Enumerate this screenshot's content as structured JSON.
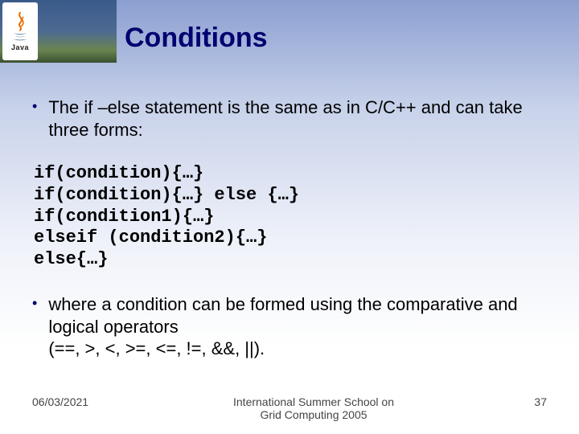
{
  "logo": {
    "text": "Java"
  },
  "title": "Conditions",
  "bullets": {
    "b1": "The if –else  statement is the same as in C/C++ and can take three forms:",
    "b2_line1": "where a condition can be formed using the comparative and logical operators",
    "b2_line2": "(==, >, <, >=, <=, !=, &&, ||)."
  },
  "code": "if(condition){…}\nif(condition){…} else {…}\nif(condition1){…}\nelseif (condition2){…}\nelse{…}",
  "footer": {
    "date": "06/03/2021",
    "venue_l1": "International Summer School on",
    "venue_l2": "Grid Computing 2005",
    "page": "37"
  }
}
